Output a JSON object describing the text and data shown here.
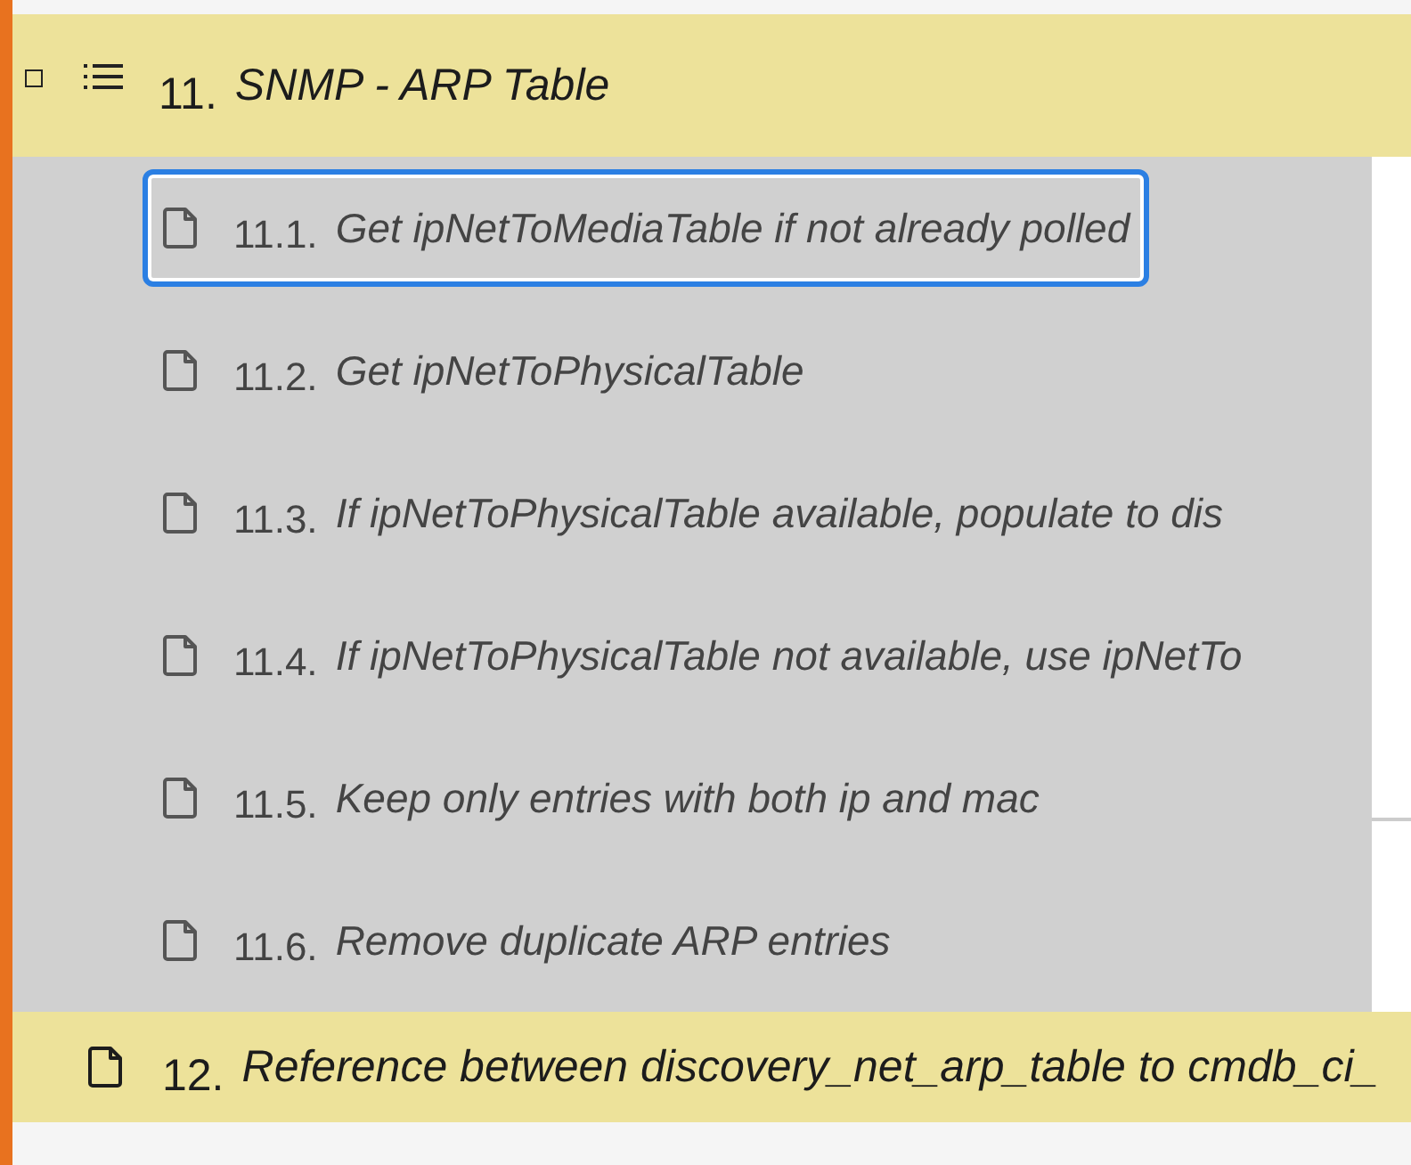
{
  "sections": [
    {
      "kind": "group",
      "number": "11.",
      "title": "SNMP - ARP Table",
      "checked": false,
      "children": [
        {
          "number": "11.1.",
          "title": "Get ipNetToMediaTable if not already polled",
          "selected": true
        },
        {
          "number": "11.2.",
          "title": "Get ipNetToPhysicalTable",
          "selected": false
        },
        {
          "number": "11.3.",
          "title": "If ipNetToPhysicalTable available, populate to dis",
          "selected": false
        },
        {
          "number": "11.4.",
          "title": "If ipNetToPhysicalTable not available, use ipNetTo",
          "selected": false
        },
        {
          "number": "11.5.",
          "title": "Keep only entries with both ip and mac",
          "selected": false
        },
        {
          "number": "11.6.",
          "title": "Remove duplicate ARP entries",
          "selected": false
        }
      ]
    },
    {
      "kind": "leaf",
      "number": "12.",
      "title": "Reference between discovery_net_arp_table to cmdb_ci_"
    }
  ]
}
